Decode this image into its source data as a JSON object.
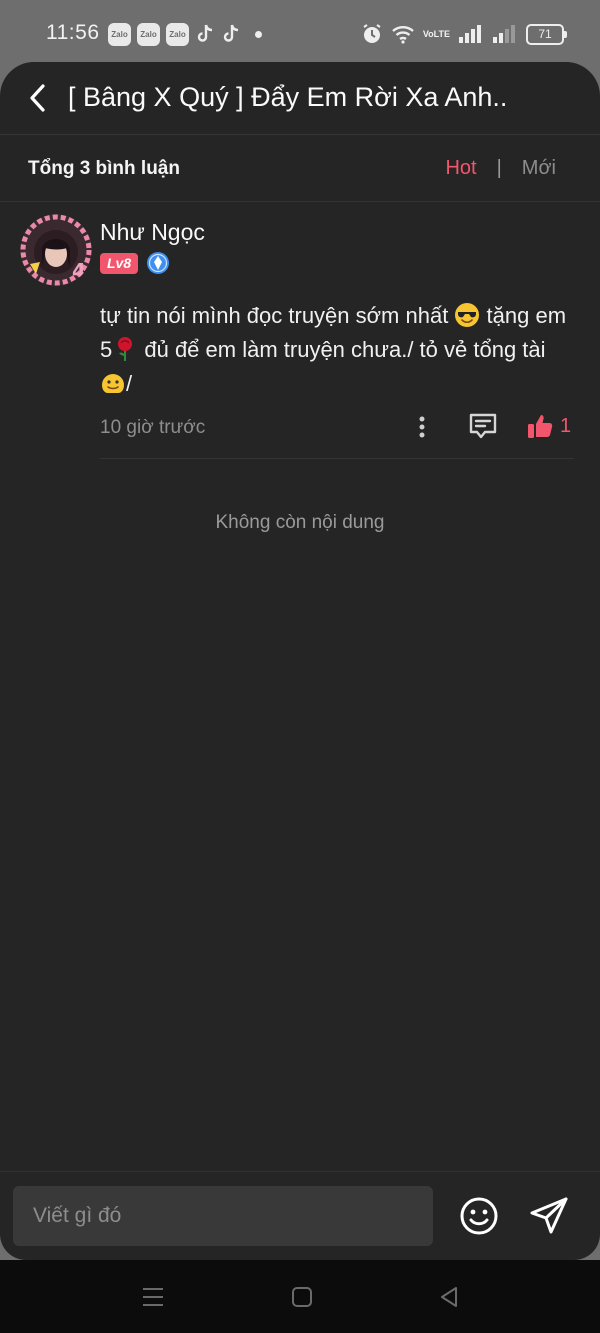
{
  "status_bar": {
    "time": "11:56",
    "app_icons": [
      "Zalo",
      "Zalo",
      "Zalo"
    ],
    "network_label": "VoLTE",
    "battery": "71"
  },
  "header": {
    "title": "[ Bâng X Quý ] Đẩy Em Rời Xa Anh.."
  },
  "comments_bar": {
    "total_label": "Tổng 3 bình luận",
    "sort_hot": "Hot",
    "sort_separator": "|",
    "sort_new": "Mới",
    "active_sort_color": "#f2566d"
  },
  "comment": {
    "username": "Như Ngọc",
    "level_badge": "Lv8",
    "text_part1": "tự tin nói mình đọc truyện sớm nhất ",
    "text_part2": " tặng em 5",
    "text_part3": " đủ để em làm truyện chưa./ tỏ vẻ tổng tài ",
    "text_part4": "/",
    "timestamp": "10 giờ trước",
    "like_count": "1",
    "icons": [
      "more-vertical-icon",
      "reply-icon",
      "thumbs-up-icon"
    ]
  },
  "end_message": "Không còn nội dung",
  "composer": {
    "placeholder": "Viết gì đó"
  },
  "accent_color": "#f2566d"
}
